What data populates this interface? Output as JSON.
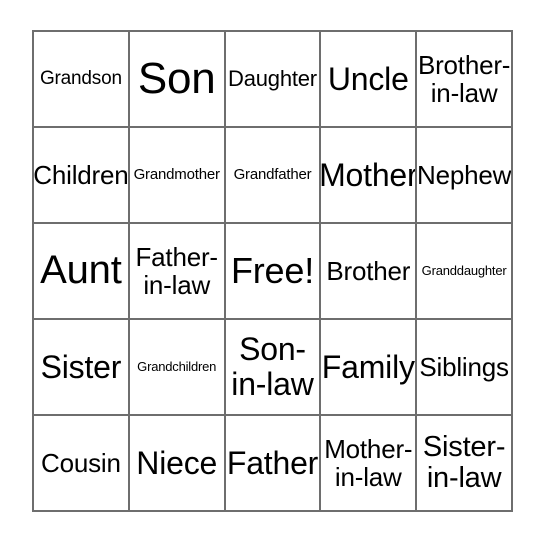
{
  "card": {
    "type": "bingo-card",
    "rows": 5,
    "columns": 5,
    "free_space_label": "Free!",
    "free_space_position": {
      "row": 3,
      "column": 3
    },
    "colors": {
      "background": "#ffffff",
      "grid_line": "#6e6e6e",
      "text": "#000000"
    },
    "cells": [
      {
        "row": 1,
        "col": 1,
        "text": "Grandson",
        "size": "sz-xxs"
      },
      {
        "row": 1,
        "col": 2,
        "text": "Son",
        "size": "sz-xxl"
      },
      {
        "row": 1,
        "col": 3,
        "text": "Daughter",
        "size": "sz-xs"
      },
      {
        "row": 1,
        "col": 4,
        "text": "Uncle",
        "size": "sz-m"
      },
      {
        "row": 1,
        "col": 5,
        "text": "Brother-\nin-law",
        "size": "sz-s"
      },
      {
        "row": 2,
        "col": 1,
        "text": "Children",
        "size": "sz-s"
      },
      {
        "row": 2,
        "col": 2,
        "text": "Grandmother",
        "size": "sz-t"
      },
      {
        "row": 2,
        "col": 3,
        "text": "Grandfather",
        "size": "sz-t"
      },
      {
        "row": 2,
        "col": 4,
        "text": "Mother",
        "size": "sz-m"
      },
      {
        "row": 2,
        "col": 5,
        "text": "Nephew",
        "size": "sz-s"
      },
      {
        "row": 3,
        "col": 1,
        "text": "Aunt",
        "size": "sz-xl"
      },
      {
        "row": 3,
        "col": 2,
        "text": "Father-\nin-law",
        "size": "sz-s"
      },
      {
        "row": 3,
        "col": 3,
        "text": "Free!",
        "size": "sz-l"
      },
      {
        "row": 3,
        "col": 4,
        "text": "Brother",
        "size": "sz-s"
      },
      {
        "row": 3,
        "col": 5,
        "text": "Granddaughter",
        "size": "sz-tt"
      },
      {
        "row": 4,
        "col": 1,
        "text": "Sister",
        "size": "sz-m"
      },
      {
        "row": 4,
        "col": 2,
        "text": "Grandchildren",
        "size": "sz-tt"
      },
      {
        "row": 4,
        "col": 3,
        "text": "Son-\nin-law",
        "size": "sz-m"
      },
      {
        "row": 4,
        "col": 4,
        "text": "Family",
        "size": "sz-m"
      },
      {
        "row": 4,
        "col": 5,
        "text": "Siblings",
        "size": "sz-s"
      },
      {
        "row": 5,
        "col": 1,
        "text": "Cousin",
        "size": "sz-s"
      },
      {
        "row": 5,
        "col": 2,
        "text": "Niece",
        "size": "sz-m"
      },
      {
        "row": 5,
        "col": 3,
        "text": "Father",
        "size": "sz-m"
      },
      {
        "row": 5,
        "col": 4,
        "text": "Mother-\nin-law",
        "size": "sz-s"
      },
      {
        "row": 5,
        "col": 5,
        "text": "Sister-\nin-law",
        "size": "sz-sm"
      }
    ]
  }
}
